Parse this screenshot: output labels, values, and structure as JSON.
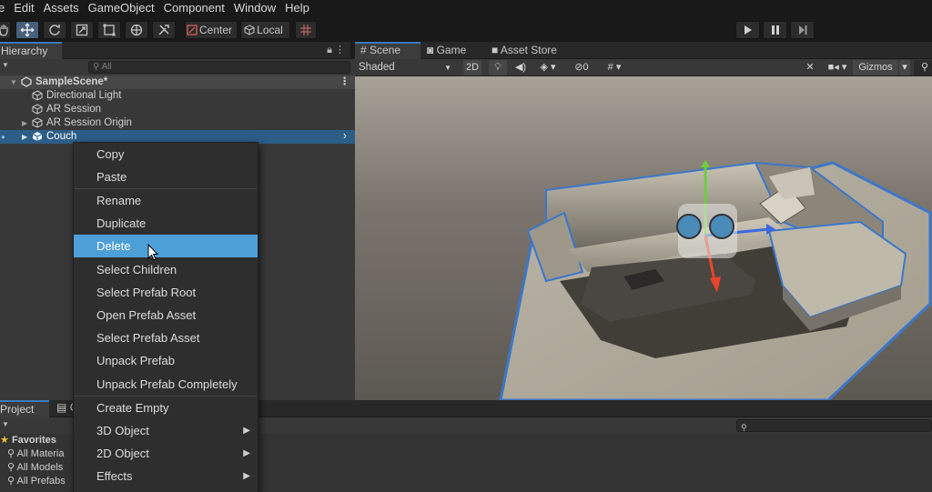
{
  "menubar": [
    "e",
    "Edit",
    "Assets",
    "GameObject",
    "Component",
    "Window",
    "Help"
  ],
  "toolbar": {
    "center_label": "Center",
    "local_label": "Local"
  },
  "hierarchy": {
    "tab_label": "Hierarchy",
    "search_placeholder": "All",
    "scene_name": "SampleScene*",
    "items": [
      "Directional Light",
      "AR Session",
      "AR Session Origin",
      "Couch"
    ]
  },
  "scene_tabs": [
    "Scene",
    "Game",
    "Asset Store"
  ],
  "scene_toolbar": {
    "shading": "Shaded",
    "mode_2d": "2D",
    "hidden_count": "0",
    "gizmos": "Gizmos"
  },
  "project": {
    "tab_label": "Project",
    "tab2_label": "C",
    "favorites_label": "Favorites",
    "items": [
      "All Materia",
      "All Models",
      "All Prefabs"
    ]
  },
  "context_menu": {
    "items": [
      "Copy",
      "Paste",
      "Rename",
      "Duplicate",
      "Delete",
      "Select Children",
      "Select Prefab Root",
      "Open Prefab Asset",
      "Select Prefab Asset",
      "Unpack Prefab",
      "Unpack Prefab Completely",
      "Create Empty",
      "3D Object",
      "2D Object",
      "Effects"
    ],
    "highlighted": "Delete"
  },
  "colors": {
    "selection": "#2c5d87",
    "menu_highlight": "#4d9fd8",
    "tab_accent": "#3a79bb",
    "outline": "#3c77c9"
  }
}
